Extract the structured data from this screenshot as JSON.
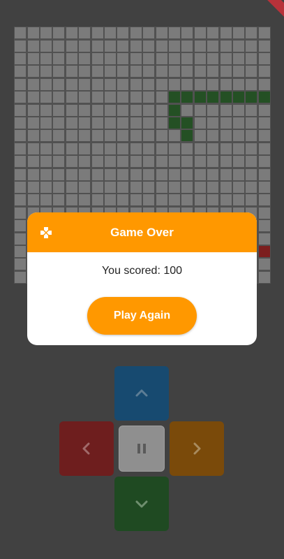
{
  "board": {
    "cols": 20,
    "rows": 20,
    "snake": [
      [
        12,
        5
      ],
      [
        13,
        5
      ],
      [
        14,
        5
      ],
      [
        15,
        5
      ],
      [
        16,
        5
      ],
      [
        17,
        5
      ],
      [
        18,
        5
      ],
      [
        19,
        5
      ],
      [
        12,
        6
      ],
      [
        12,
        7
      ],
      [
        13,
        7
      ],
      [
        13,
        8
      ]
    ],
    "food": [
      [
        19,
        17
      ]
    ]
  },
  "colors": {
    "background": "#414141",
    "cell": "#7b7b7b",
    "snake": "#245024",
    "food": "#7c1e1e",
    "accent": "#ff9800",
    "up": "#174a70",
    "left": "#6e1e1e",
    "right": "#7a4a0a",
    "down": "#1f4a22"
  },
  "dialog": {
    "title": "Game Over",
    "icon": "gamepad-icon",
    "score_text": "You scored: 100",
    "play_again_label": "Play Again"
  },
  "controls": {
    "up_icon": "chevron-up-icon",
    "left_icon": "chevron-left-icon",
    "pause_icon": "pause-icon",
    "right_icon": "chevron-right-icon",
    "down_icon": "chevron-down-icon"
  }
}
